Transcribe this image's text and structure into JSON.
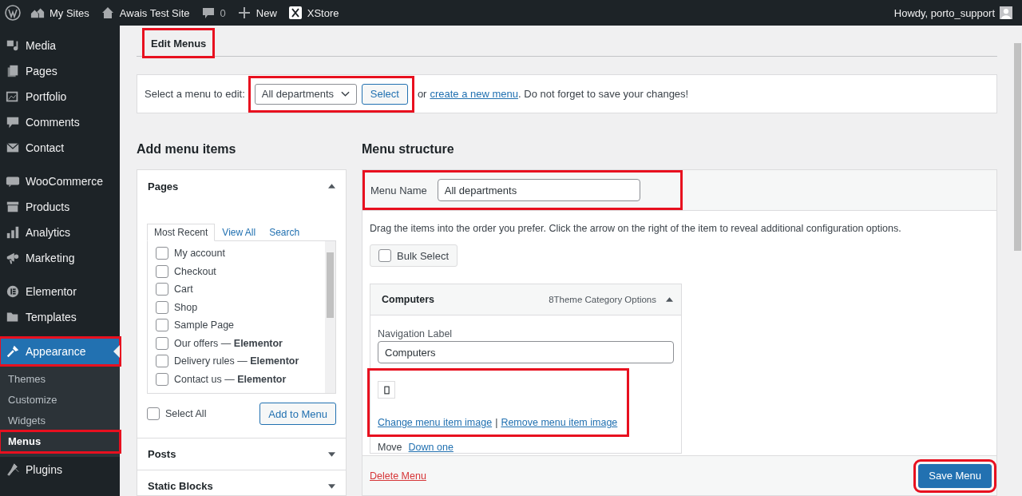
{
  "admin_bar": {
    "items": [
      {
        "label": "My Sites"
      },
      {
        "label": "Awais Test Site"
      },
      {
        "label": "0"
      },
      {
        "label": "New"
      },
      {
        "label": "XStore"
      }
    ],
    "greeting": "Howdy, porto_support"
  },
  "sidebar": {
    "groups": [
      [
        {
          "label": "Media",
          "selected": false,
          "highlighted": false
        },
        {
          "label": "Pages",
          "selected": false,
          "highlighted": false
        },
        {
          "label": "Portfolio",
          "selected": false,
          "highlighted": false
        },
        {
          "label": "Comments",
          "selected": false,
          "highlighted": false
        },
        {
          "label": "Contact",
          "selected": false,
          "highlighted": false
        }
      ],
      [
        {
          "label": "WooCommerce",
          "selected": false,
          "highlighted": false
        },
        {
          "label": "Products",
          "selected": false,
          "highlighted": false
        },
        {
          "label": "Analytics",
          "selected": false,
          "highlighted": false
        },
        {
          "label": "Marketing",
          "selected": false,
          "highlighted": false
        }
      ],
      [
        {
          "label": "Elementor",
          "selected": false,
          "highlighted": false
        },
        {
          "label": "Templates",
          "selected": false,
          "highlighted": false
        }
      ],
      [
        {
          "label": "Appearance",
          "selected": true,
          "highlighted": true,
          "children": [
            {
              "label": "Themes",
              "selected": false,
              "highlighted": false
            },
            {
              "label": "Customize",
              "selected": false,
              "highlighted": false
            },
            {
              "label": "Widgets",
              "selected": false,
              "highlighted": false
            },
            {
              "label": "Menus",
              "selected": true,
              "highlighted": true
            }
          ]
        },
        {
          "label": "Plugins",
          "selected": false,
          "highlighted": false
        }
      ]
    ]
  },
  "page_tab": {
    "label": "Edit Menus",
    "highlighted": true
  },
  "select_menu": {
    "label": "Select a menu to edit:",
    "value": "All departments",
    "button": "Select",
    "highlighted": true,
    "or_text": "or",
    "link": "create a new menu",
    "tail": ". Do not forget to save your changes!"
  },
  "add_items": {
    "title": "Add menu items",
    "sections": [
      {
        "title": "Pages",
        "expanded": true,
        "tabs": [
          {
            "label": "Most Recent",
            "selected": true
          },
          {
            "label": "View All",
            "selected": false
          },
          {
            "label": "Search",
            "selected": false
          }
        ],
        "items": [
          {
            "label": "My account",
            "checked": false
          },
          {
            "label": "Checkout",
            "checked": false
          },
          {
            "label": "Cart",
            "checked": false
          },
          {
            "label": "Shop",
            "checked": false
          },
          {
            "label": "Sample Page",
            "checked": false
          },
          {
            "label": "Our offers — **Elementor**",
            "checked": false
          },
          {
            "label": "Delivery rules — **Elementor**",
            "checked": false
          },
          {
            "label": "Contact us — **Elementor**",
            "checked": false
          }
        ],
        "select_all": {
          "label": "Select All",
          "checked": false
        },
        "button": "Add to Menu"
      },
      {
        "title": "Posts",
        "expanded": false
      },
      {
        "title": "Static Blocks",
        "expanded": false
      }
    ]
  },
  "structure": {
    "title": "Menu structure",
    "name_label": "Menu Name",
    "name_value": "All departments",
    "name_highlighted": true,
    "instructions": "Drag the items into the order you prefer. Click the arrow on the right of the item to reveal additional configuration options.",
    "bulk_select": {
      "label": "Bulk Select",
      "checked": false
    },
    "items": [
      {
        "title": "Computers",
        "options": "8Theme Category Options",
        "expanded": true,
        "nav_label": "Navigation Label",
        "nav_value": "Computers",
        "image_highlighted": true,
        "change_link": "Change menu item image",
        "separator": "|",
        "remove_link": "Remove menu item image",
        "move_label": "Move",
        "move_link": "Down one"
      }
    ],
    "delete_link": "Delete Menu",
    "save_button": "Save Menu",
    "save_highlighted": true
  }
}
